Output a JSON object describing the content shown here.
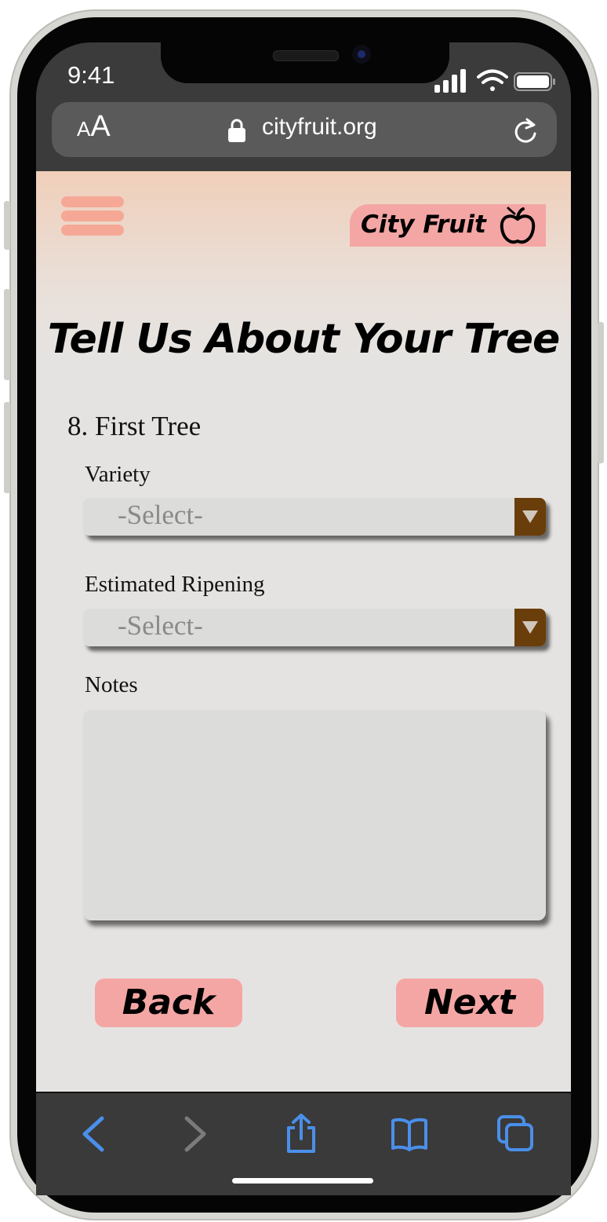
{
  "status_bar": {
    "time": "9:41",
    "icons": [
      "signal-icon",
      "wifi-icon",
      "battery-icon"
    ]
  },
  "browser": {
    "text_size_small": "A",
    "text_size_large": "A",
    "url": "cityfruit.org",
    "icons": [
      "lock-icon",
      "reload-icon"
    ]
  },
  "header": {
    "menu_icon": "hamburger-menu-icon",
    "logo_text": "City Fruit",
    "logo_icon": "apple-icon"
  },
  "form": {
    "title": "Tell Us About Your Tree",
    "section_title": "8. First Tree",
    "variety_label": "Variety",
    "variety_value": "-Select-",
    "ripening_label": "Estimated Ripening",
    "ripening_value": "-Select-",
    "notes_label": "Notes",
    "notes_value": ""
  },
  "buttons": {
    "back": "Back",
    "next": "Next"
  },
  "toolbar": {
    "icons": [
      "back-arrow-icon",
      "forward-arrow-icon",
      "share-icon",
      "bookmarks-icon",
      "tabs-icon"
    ]
  },
  "colors": {
    "accent_pink": "#f4a6a4",
    "menu_salmon": "#f6a896",
    "dropdown_brown": "#6a3e0a",
    "ios_blue": "#4a8fea"
  }
}
